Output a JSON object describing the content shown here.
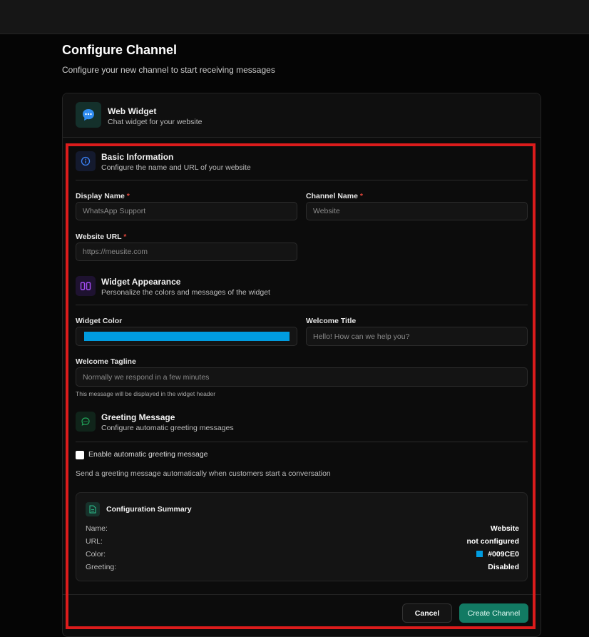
{
  "page": {
    "title": "Configure Channel",
    "subtitle": "Configure your new channel to start receiving messages"
  },
  "channel": {
    "icon": "chat-bubble-icon",
    "title": "Web Widget",
    "subtitle": "Chat widget for your website"
  },
  "basic_info": {
    "icon": "info-icon",
    "title": "Basic Information",
    "subtitle": "Configure the name and URL of your website",
    "display_name": {
      "label": "Display Name",
      "required": "*",
      "placeholder": "WhatsApp Support",
      "value": ""
    },
    "channel_name": {
      "label": "Channel Name",
      "required": "*",
      "placeholder": "Website",
      "value": ""
    },
    "website_url": {
      "label": "Website URL",
      "required": "*",
      "placeholder": "https://meusite.com",
      "value": ""
    }
  },
  "appearance": {
    "icon": "palette-icon",
    "title": "Widget Appearance",
    "subtitle": "Personalize the colors and messages of the widget",
    "widget_color": {
      "label": "Widget Color",
      "value": "#009CE0"
    },
    "welcome_title": {
      "label": "Welcome Title",
      "placeholder": "Hello! How can we help you?",
      "value": ""
    },
    "welcome_tagline": {
      "label": "Welcome Tagline",
      "placeholder": "Normally we respond in a few minutes",
      "value": "",
      "hint": "This message will be displayed in the widget header"
    }
  },
  "greeting": {
    "icon": "message-circle-icon",
    "title": "Greeting Message",
    "subtitle": "Configure automatic greeting messages",
    "checkbox_label": "Enable automatic greeting message",
    "checked": false,
    "description": "Send a greeting message automatically when customers start a conversation"
  },
  "summary": {
    "icon": "document-icon",
    "title": "Configuration Summary",
    "rows": [
      {
        "key": "Name:",
        "value": "Website"
      },
      {
        "key": "URL:",
        "value": "not configured"
      },
      {
        "key": "Color:",
        "value": "#009CE0"
      },
      {
        "key": "Greeting:",
        "value": "Disabled"
      }
    ]
  },
  "actions": {
    "cancel_label": "Cancel",
    "create_label": "Create Channel"
  },
  "colors": {
    "accent": "#127a63",
    "widget": "#009CE0",
    "highlight_frame": "#dc1c1c",
    "required": "#e0453a"
  }
}
